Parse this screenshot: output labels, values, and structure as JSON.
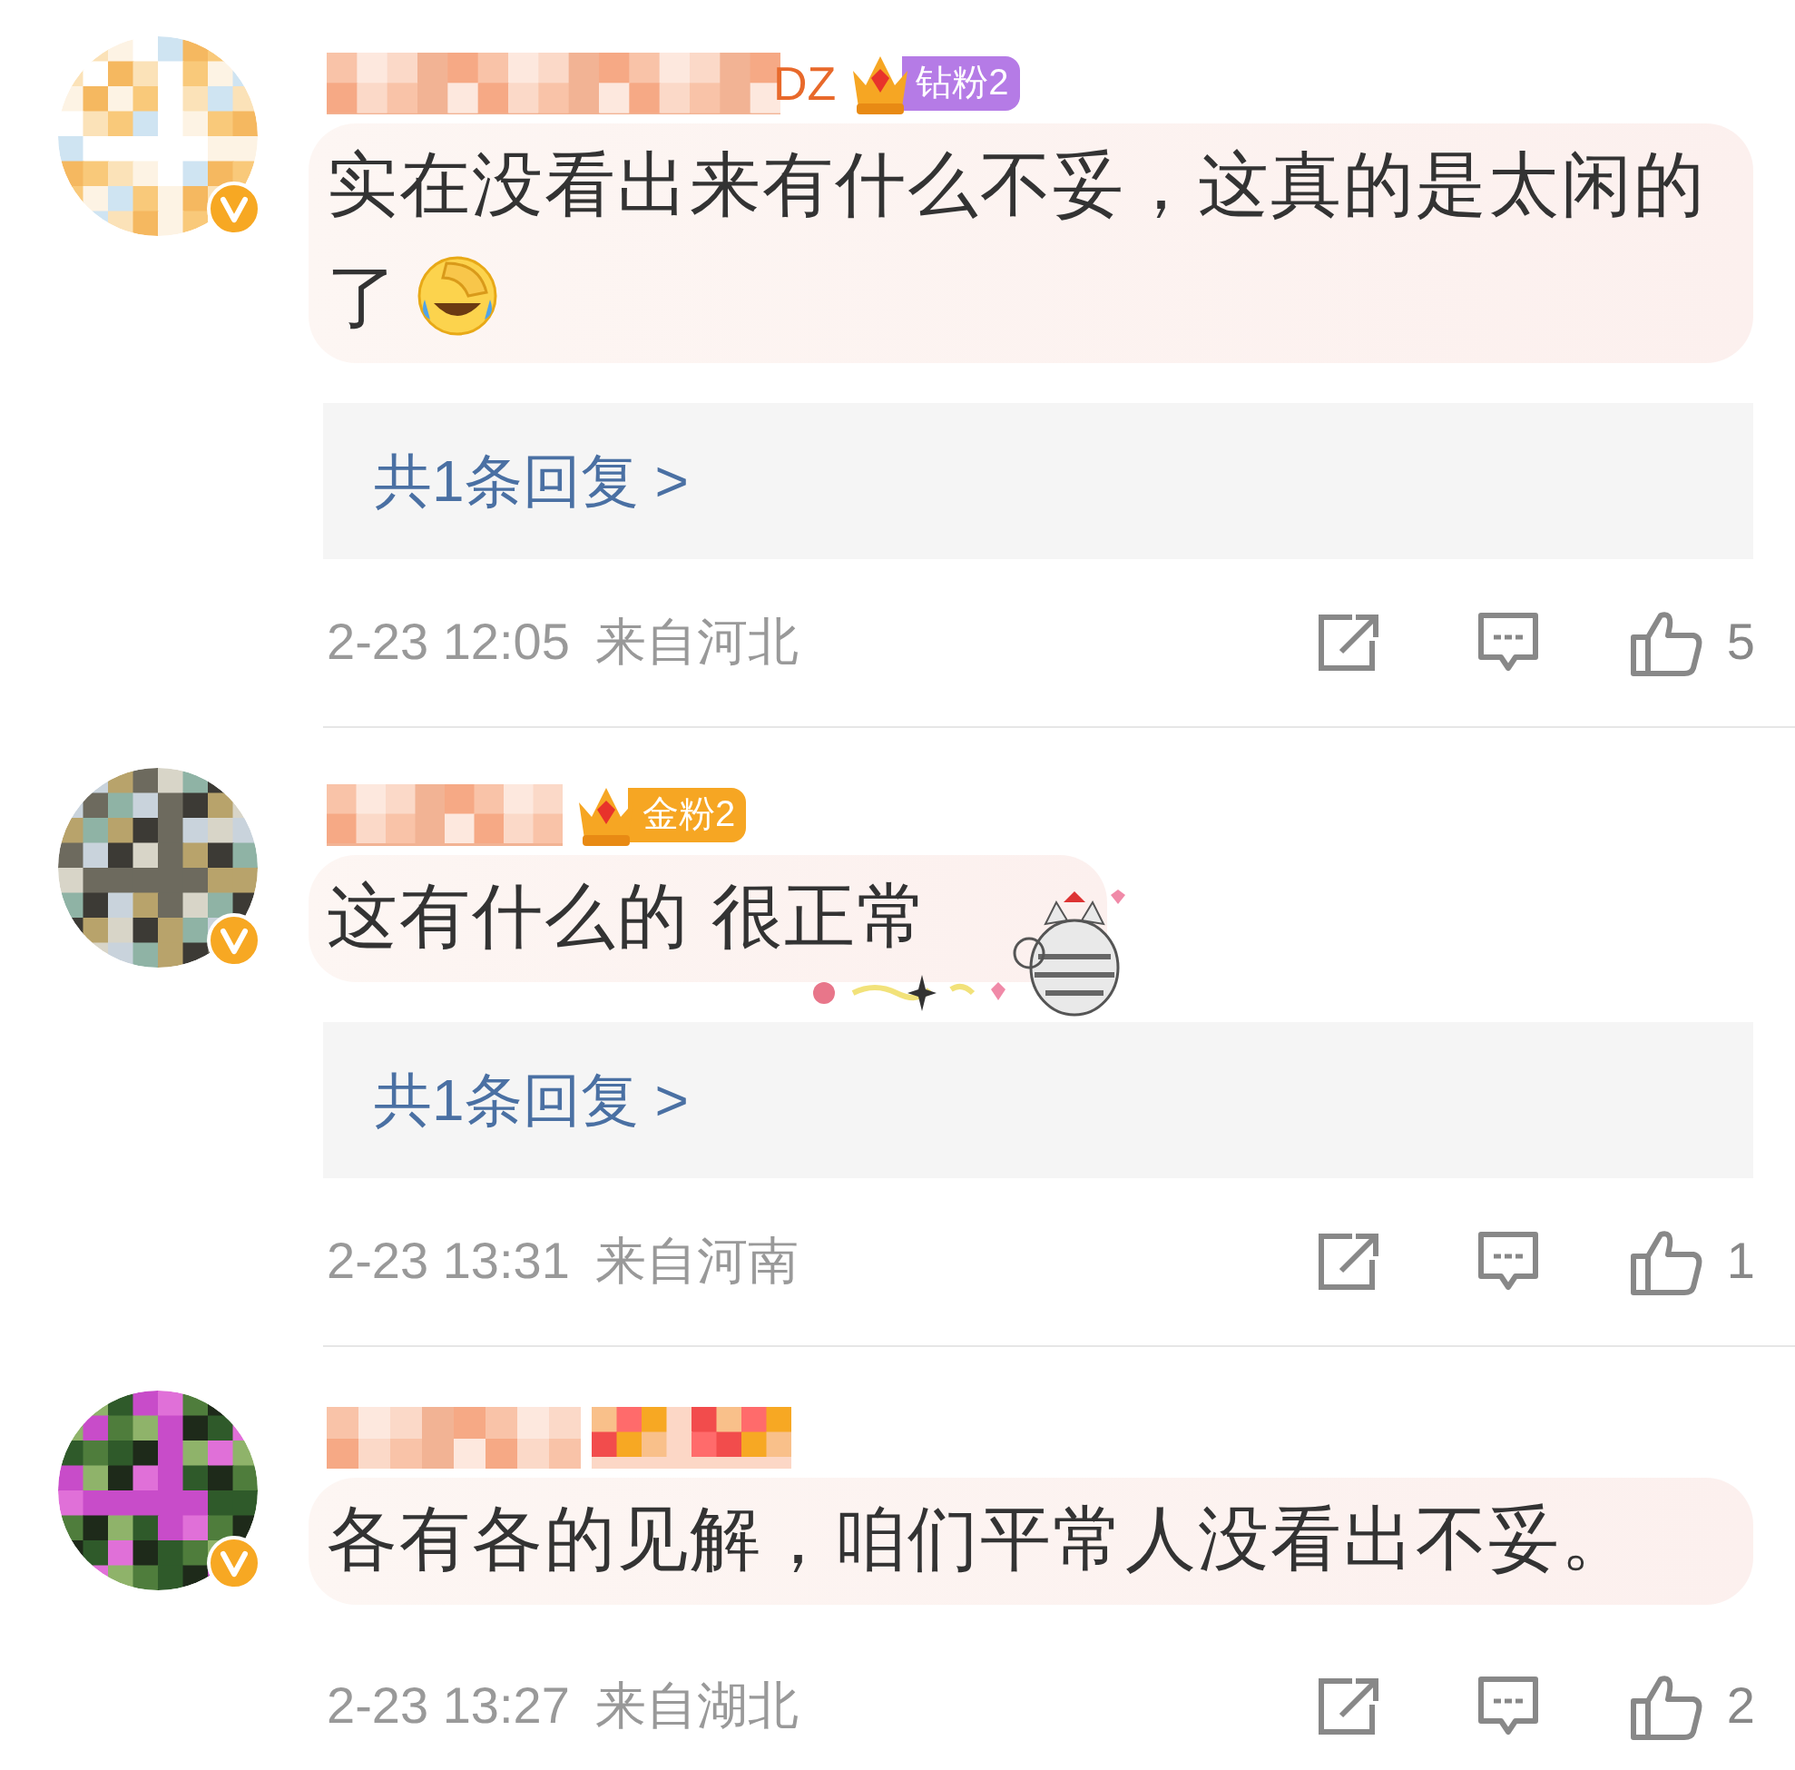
{
  "comments": [
    {
      "verified": true,
      "name_blurred": true,
      "name_tail": "DZ",
      "badge": {
        "kind": "crown",
        "label": "钻粉2",
        "color": "#b57be6"
      },
      "text": "实在没看出来有什么不妥，这真的是太闲的了",
      "emoji": true,
      "sticker": false,
      "reply_link": "共1条回复 >",
      "time": "2-23 12:05",
      "location": "来自河北",
      "likes": "5"
    },
    {
      "verified": true,
      "name_blurred": true,
      "badge": {
        "kind": "crown",
        "label": "金粉2",
        "color": "#f6a623"
      },
      "text": "这有什么的  很正常",
      "emoji": false,
      "sticker": true,
      "reply_link": "共1条回复 >",
      "time": "2-23 13:31",
      "location": "来自河南",
      "likes": "1"
    },
    {
      "verified": true,
      "name_blurred": true,
      "badge": {
        "kind": "blurred"
      },
      "text": "各有各的见解，咱们平常人没看出不妥。",
      "emoji": false,
      "sticker": false,
      "time": "2-23 13:27",
      "location": "来自湖北",
      "likes": "2"
    }
  ]
}
